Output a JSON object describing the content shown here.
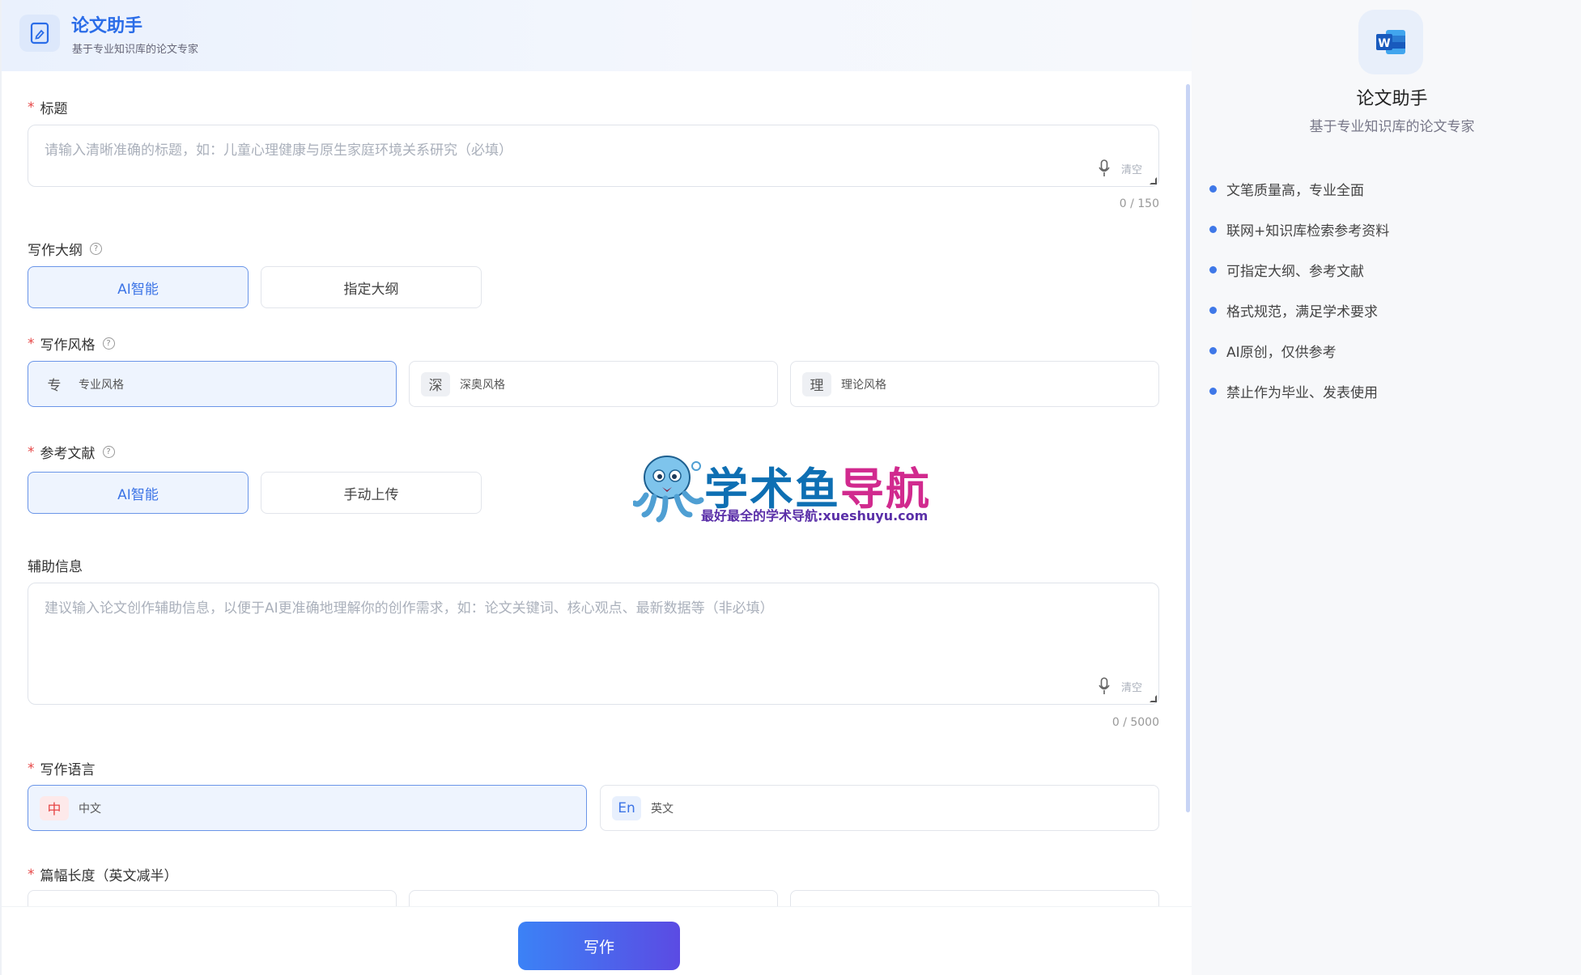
{
  "header": {
    "title": "论文助手",
    "subtitle": "基于专业知识库的论文专家"
  },
  "title_field": {
    "label": "标题",
    "placeholder": "请输入清晰准确的标题，如：儿童心理健康与原生家庭环境关系研究（必填）",
    "clear_label": "清空",
    "counter": "0 / 150"
  },
  "outline": {
    "label": "写作大纲",
    "options": [
      "AI智能",
      "指定大纲"
    ],
    "selected": "AI智能"
  },
  "style": {
    "label": "写作风格",
    "options": [
      {
        "badge": "专",
        "text": "专业风格"
      },
      {
        "badge": "深",
        "text": "深奥风格"
      },
      {
        "badge": "理",
        "text": "理论风格"
      }
    ],
    "selected": "专业风格"
  },
  "references": {
    "label": "参考文献",
    "options": [
      "AI智能",
      "手动上传"
    ],
    "selected": "AI智能"
  },
  "aux_info": {
    "label": "辅助信息",
    "placeholder": "建议输入论文创作辅助信息，以便于AI更准确地理解你的创作需求，如：论文关键词、核心观点、最新数据等（非必填）",
    "clear_label": "清空",
    "counter": "0 / 5000"
  },
  "language": {
    "label": "写作语言",
    "options": [
      {
        "badge": "中",
        "text": "中文"
      },
      {
        "badge": "En",
        "text": "英文"
      }
    ],
    "selected": "中文"
  },
  "length": {
    "label": "篇幅长度（英文减半）"
  },
  "write_button": "写作",
  "watermark": {
    "title_part1": "学术鱼",
    "title_part2": "导航",
    "subtitle": "最好最全的学术导航:xueshuyu.com"
  },
  "sidebar": {
    "title": "论文助手",
    "subtitle": "基于专业知识库的论文专家",
    "features": [
      "文笔质量高，专业全面",
      "联网+知识库检索参考资料",
      "可指定大纲、参考文献",
      "格式规范，满足学术要求",
      "AI原创，仅供参考",
      "禁止作为毕业、发表使用"
    ]
  },
  "colors": {
    "accent": "#3c74e6",
    "active_bg": "#eef4fe",
    "active_border": "#6a95e8",
    "required": "#e64545"
  }
}
